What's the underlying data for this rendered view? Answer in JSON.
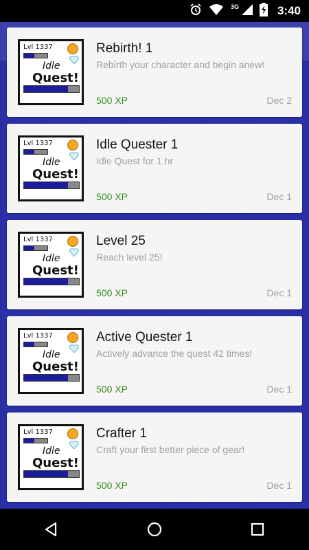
{
  "status_bar": {
    "time": "3:40",
    "network": "3G",
    "icons": [
      "alarm-icon",
      "wifi-icon",
      "signal-icon",
      "battery-charging-icon"
    ]
  },
  "thumbnail": {
    "level_text": "Lvl 1337",
    "word1": "Idle",
    "word2": "Quest!"
  },
  "achievements": [
    {
      "title": "Rebirth! 1",
      "description": "Rebirth your character and begin anew!",
      "xp": "500 XP",
      "date": "Dec 2"
    },
    {
      "title": "Idle Quester 1",
      "description": "Idle Quest for 1 hr",
      "xp": "500 XP",
      "date": "Dec 1"
    },
    {
      "title": "Level 25",
      "description": "Reach level 25!",
      "xp": "500 XP",
      "date": "Dec 1"
    },
    {
      "title": "Active Quester 1",
      "description": "Actively advance the quest 42 times!",
      "xp": "500 XP",
      "date": "Dec 1"
    },
    {
      "title": "Crafter 1",
      "description": "Craft your first better piece of gear!",
      "xp": "500 XP",
      "date": "Dec 1"
    }
  ],
  "nav": {
    "icons": [
      "back-icon",
      "home-icon",
      "recents-icon"
    ]
  },
  "colors": {
    "xp": "#3a8a1f",
    "backdrop": "#2b30a9",
    "card": "#f5f5f5"
  }
}
